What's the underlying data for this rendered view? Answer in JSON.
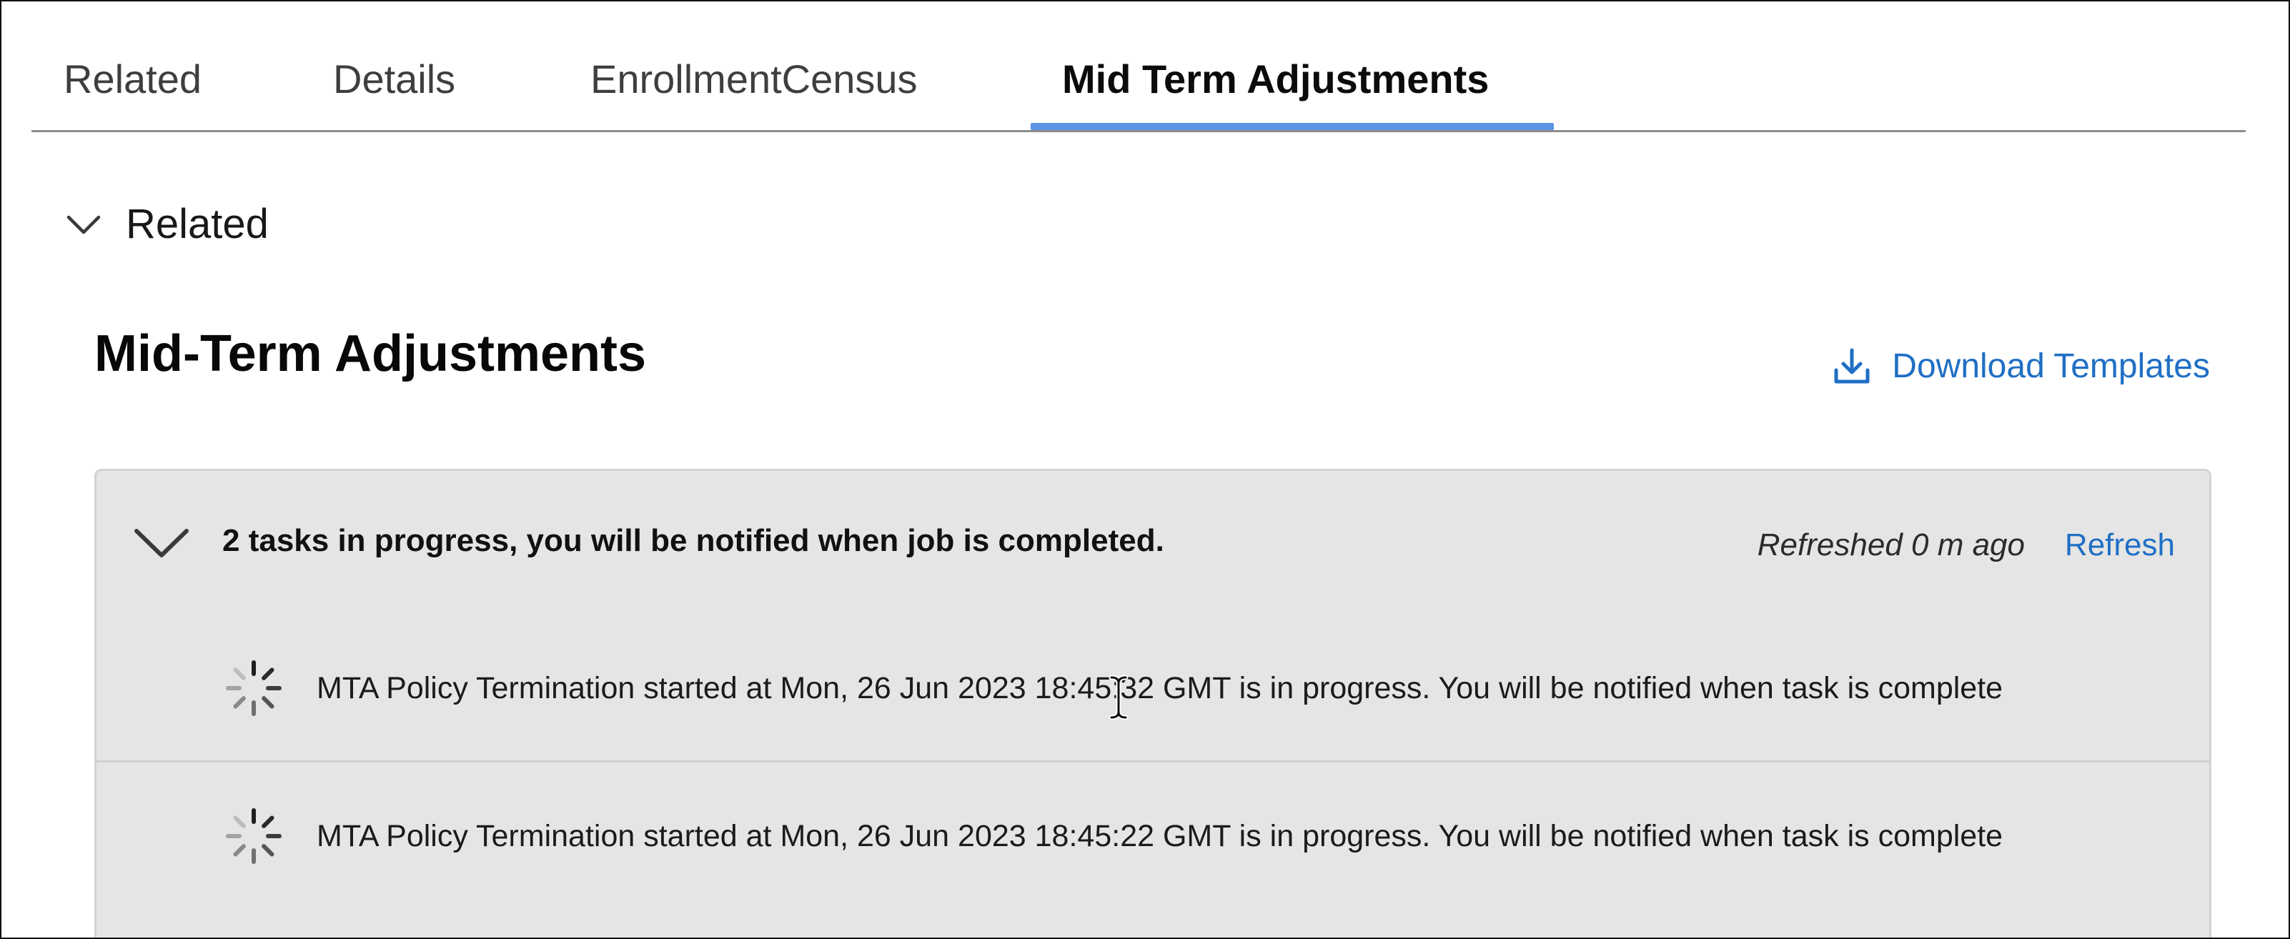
{
  "tabs": [
    {
      "label": "Related",
      "active": false
    },
    {
      "label": "Details",
      "active": false
    },
    {
      "label": "EnrollmentCensus",
      "active": false
    },
    {
      "label": "Mid Term Adjustments",
      "active": true
    }
  ],
  "section": {
    "title": "Related",
    "toggle_icon": "chevron-down-icon"
  },
  "card": {
    "title": "Mid-Term Adjustments",
    "download_label": "Download Templates",
    "download_icon": "download-icon"
  },
  "jobs": {
    "summary": "2 tasks in progress, you will be notified when job is completed.",
    "refreshed": "Refreshed 0 m ago",
    "refresh_label": "Refresh",
    "tasks": [
      {
        "text": "MTA Policy Termination started at Mon, 26 Jun 2023 18:45:32 GMT is in progress. You will be notified when task is complete",
        "status_icon": "spinner-icon"
      },
      {
        "text": "MTA Policy Termination started at Mon, 26 Jun 2023 18:45:22 GMT is in progress. You will be notified when task is complete",
        "status_icon": "spinner-icon"
      }
    ]
  },
  "colors": {
    "accent_blue": "#1f6fc5",
    "tab_indicator": "#5b94e6",
    "panel_bg": "#e5e5e5"
  }
}
